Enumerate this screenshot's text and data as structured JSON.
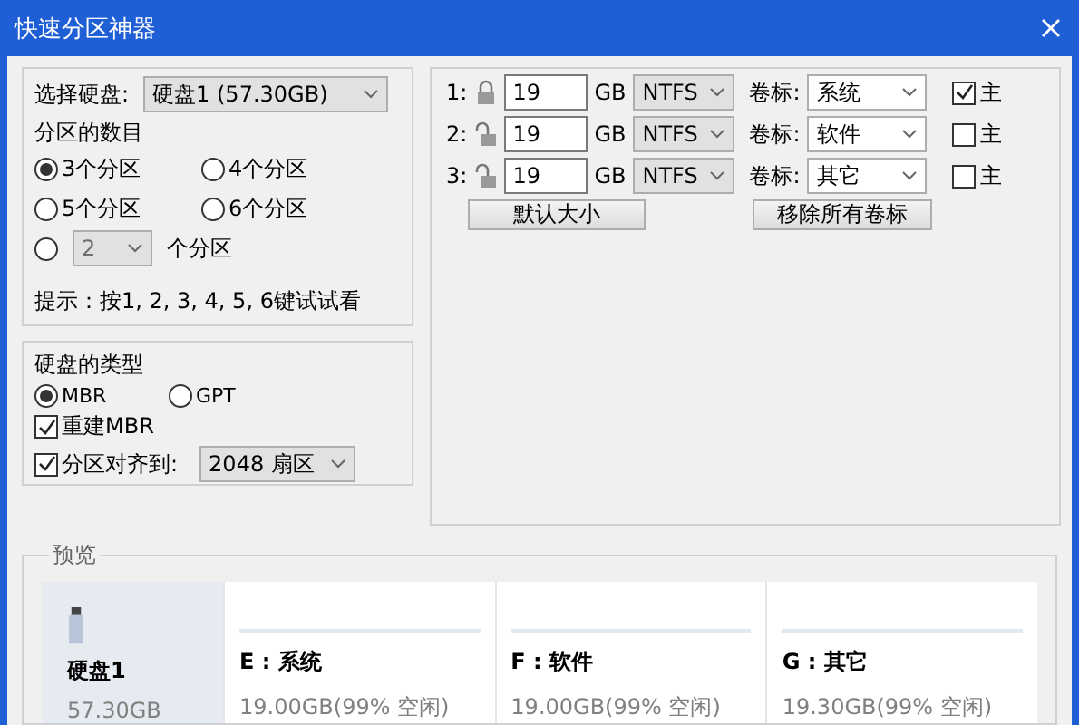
{
  "window": {
    "title": "快速分区神器"
  },
  "disk_select": {
    "label": "选择硬盘:",
    "value": "硬盘1 (57.30GB)"
  },
  "partition_count": {
    "title": "分区的数目",
    "options": [
      {
        "label": "3个分区",
        "selected": true
      },
      {
        "label": "4个分区",
        "selected": false
      },
      {
        "label": "5个分区",
        "selected": false
      },
      {
        "label": "6个分区",
        "selected": false
      }
    ],
    "custom": {
      "selected": false,
      "value": "2",
      "disabled": true,
      "suffix": "个分区"
    }
  },
  "hint": "提示：按1, 2, 3, 4, 5, 6键试试看",
  "disk_type": {
    "title": "硬盘的类型",
    "options": [
      {
        "label": "MBR",
        "selected": true
      },
      {
        "label": "GPT",
        "selected": false
      }
    ],
    "rebuild_mbr": {
      "label": "重建MBR",
      "checked": true
    },
    "align": {
      "label": "分区对齐到:",
      "checked": true,
      "value": "2048 扇区"
    }
  },
  "partitions": [
    {
      "index": "1:",
      "locked": true,
      "size": "19",
      "unit": "GB",
      "fs": "NTFS",
      "label_caption": "卷标:",
      "label": "系统",
      "primary_caption": "主",
      "primary": true
    },
    {
      "index": "2:",
      "locked": false,
      "size": "19",
      "unit": "GB",
      "fs": "NTFS",
      "label_caption": "卷标:",
      "label": "软件",
      "primary_caption": "主",
      "primary": false
    },
    {
      "index": "3:",
      "locked": false,
      "size": "19",
      "unit": "GB",
      "fs": "NTFS",
      "label_caption": "卷标:",
      "label": "其它",
      "primary_caption": "主",
      "primary": false
    }
  ],
  "buttons": [
    "默认大小",
    "移除所有卷标"
  ],
  "preview": {
    "title": "预览",
    "disk": {
      "name": "硬盘1",
      "size": "57.30GB"
    },
    "volumes": [
      {
        "name": "E : 系统",
        "info": "19.00GB(99% 空闲)"
      },
      {
        "name": "F : 软件",
        "info": "19.00GB(99% 空闲)"
      },
      {
        "name": "G : 其它",
        "info": "19.30GB(99% 空闲)"
      }
    ]
  }
}
